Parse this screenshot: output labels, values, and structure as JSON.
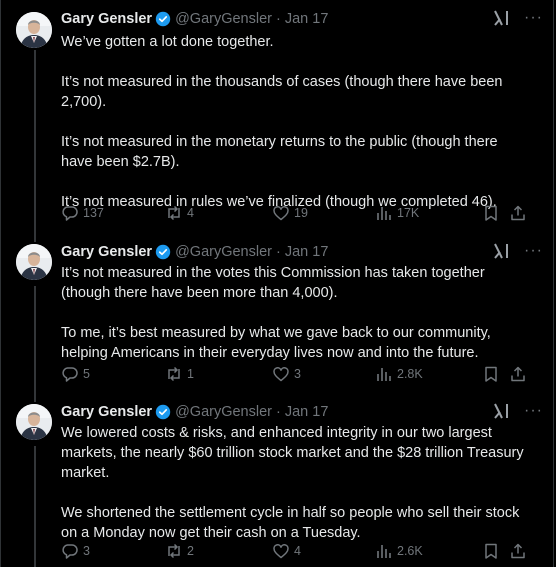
{
  "tweets": [
    {
      "author": "Gary Gensler",
      "handle": "@GaryGensler",
      "sep": "·",
      "date": "Jan 17",
      "more": "···",
      "paragraphs": [
        "We’ve gotten a lot done together.",
        "It’s not measured in the thousands of cases (though there have been 2,700).",
        "It’s not measured in the monetary returns to the public (though there have been $2.7B).",
        "It’s not measured in rules we’ve finalized (though we completed 46)."
      ],
      "replies": "137",
      "reposts": "4",
      "likes": "19",
      "views": "17K"
    },
    {
      "author": "Gary Gensler",
      "handle": "@GaryGensler",
      "sep": "·",
      "date": "Jan 17",
      "more": "···",
      "paragraphs": [
        "It’s not measured in the votes this Commission has taken together (though there have been more than 4,000).",
        "To me, it’s best measured by what we gave back to our community, helping Americans in their everyday lives now and into the future."
      ],
      "replies": "5",
      "reposts": "1",
      "likes": "3",
      "views": "2.8K"
    },
    {
      "author": "Gary Gensler",
      "handle": "@GaryGensler",
      "sep": "·",
      "date": "Jan 17",
      "more": "···",
      "paragraphs": [
        "We lowered costs & risks, and enhanced integrity in our two largest markets, the nearly $60 trillion stock market and the $28 trillion Treasury market.",
        "We shortened the settlement cycle in half so people who sell their stock on a Monday now get their cash on a Tuesday."
      ],
      "replies": "3",
      "reposts": "2",
      "likes": "4",
      "views": "2.6K"
    }
  ],
  "colors": {
    "background": "#000000",
    "text": "#e7e9ea",
    "muted": "#71767b",
    "border": "#2f3336",
    "verified": "#1d9bf0"
  }
}
